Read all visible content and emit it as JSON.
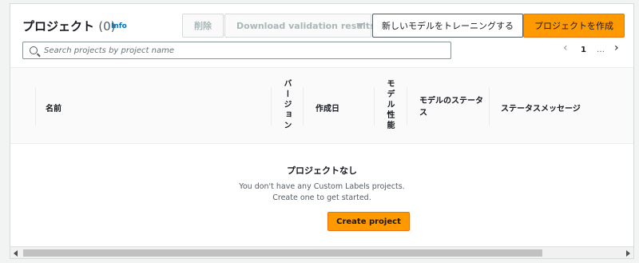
{
  "header": {
    "title": "プロジェクト",
    "count": "(0)",
    "info": "Info"
  },
  "actions": {
    "delete": "削除",
    "download": "Download validation results",
    "train": "新しいモデルをトレーニングする",
    "create": "プロジェクトを作成"
  },
  "search": {
    "placeholder": "Search projects by project name"
  },
  "pagination": {
    "current": "1",
    "ellipsis": "…"
  },
  "table": {
    "columns": {
      "name": "名前",
      "version": "バージョン",
      "created": "作成日",
      "performance": "モデル性能",
      "status": "モデルのステータス",
      "status_message": "ステータスメッセージ"
    }
  },
  "empty": {
    "title": "プロジェクトなし",
    "line1": "You don't have any Custom Labels projects.",
    "line2": "Create one to get started.",
    "button": "Create project"
  },
  "colors": {
    "primary": "#ff9900",
    "link": "#0073bb"
  }
}
